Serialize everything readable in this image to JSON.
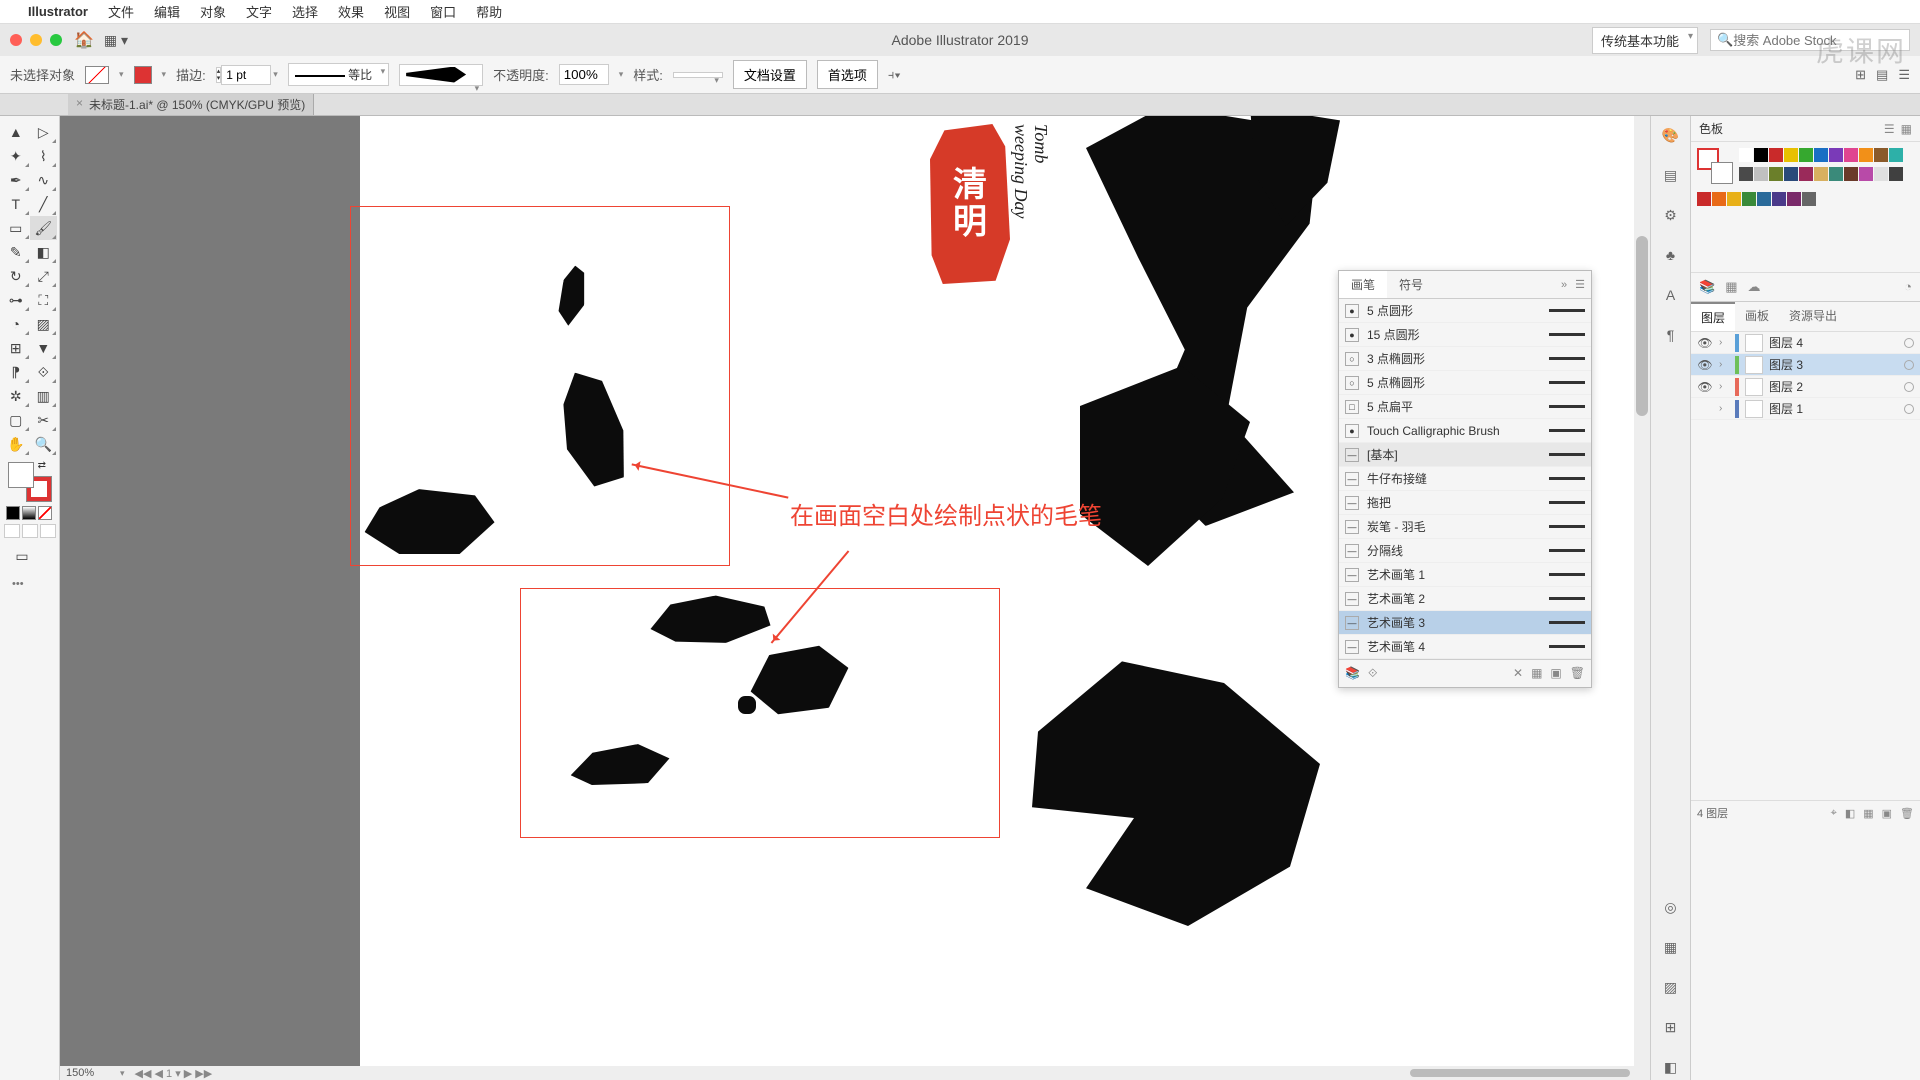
{
  "menubar": {
    "appname": "Illustrator",
    "items": [
      "文件",
      "编辑",
      "对象",
      "文字",
      "选择",
      "效果",
      "视图",
      "窗口",
      "帮助"
    ]
  },
  "titlebar": {
    "title": "Adobe Illustrator 2019",
    "workspace": "传统基本功能",
    "search_placeholder": "搜索 Adobe Stock"
  },
  "controlbar": {
    "selection": "未选择对象",
    "stroke_label": "描边:",
    "stroke_weight": "1 pt",
    "profile": "等比",
    "opacity_label": "不透明度:",
    "opacity": "100%",
    "style_label": "样式:",
    "btn_docsetup": "文档设置",
    "btn_prefs": "首选项"
  },
  "doctab": {
    "name": "未标题-1.ai* @ 150% (CMYK/GPU 预览)"
  },
  "zoom": "150%",
  "canvas": {
    "seal_top": "清",
    "seal_bot": "明",
    "calig1": "Tomb",
    "calig2": "weeping Day",
    "annotation": "在画面空白处绘制点状的毛笔"
  },
  "brushes": {
    "tab1": "画笔",
    "tab2": "符号",
    "items": [
      {
        "label": "5 点圆形",
        "thumb": "●"
      },
      {
        "label": "15 点圆形",
        "thumb": "●"
      },
      {
        "label": "3 点椭圆形",
        "thumb": "○"
      },
      {
        "label": "5 点椭圆形",
        "thumb": "○"
      },
      {
        "label": "5 点扁平",
        "thumb": "□"
      },
      {
        "label": "Touch Calligraphic Brush",
        "thumb": "●"
      },
      {
        "label": "[基本]",
        "thumb": "",
        "group": true
      },
      {
        "label": "牛仔布接缝",
        "thumb": ""
      },
      {
        "label": "拖把",
        "thumb": ""
      },
      {
        "label": "炭笔 - 羽毛",
        "thumb": ""
      },
      {
        "label": "分隔线",
        "thumb": ""
      },
      {
        "label": "艺术画笔 1",
        "thumb": ""
      },
      {
        "label": "艺术画笔 2",
        "thumb": ""
      },
      {
        "label": "艺术画笔 3",
        "thumb": "",
        "selected": true
      },
      {
        "label": "艺术画笔 4",
        "thumb": ""
      }
    ]
  },
  "swatches_panel": {
    "title": "色板"
  },
  "layers_panel": {
    "tabs": [
      "图层",
      "画板",
      "资源导出"
    ],
    "layers": [
      {
        "name": "图层 4",
        "color": "#5aa0d8",
        "visible": true
      },
      {
        "name": "图层 3",
        "color": "#6ec05a",
        "visible": true,
        "selected": true
      },
      {
        "name": "图层 2",
        "color": "#e76a5a",
        "visible": true
      },
      {
        "name": "图层 1",
        "color": "#5a7bbb",
        "visible": false
      }
    ],
    "footer": "4 图层"
  },
  "swatch_colors": [
    "#ffffff",
    "#000000",
    "#c92a2a",
    "#e8c000",
    "#36a82f",
    "#1a6fc4",
    "#7a3ab8",
    "#e04590",
    "#f29018",
    "#8a5a2a",
    "#2db0a8",
    "#4a4a4a",
    "#c0c0c0",
    "#6b7f2a",
    "#2a4a7a",
    "#9a2a5a",
    "#d8b060",
    "#3a8a7a",
    "#6a3a2a",
    "#b84aa8",
    "#e0e0e0",
    "#404040"
  ],
  "swatch_colors2": [
    "#c92a2a",
    "#e86a18",
    "#e8b018",
    "#3a8a3a",
    "#2a6a9a",
    "#4a3a8a",
    "#7a2a6a",
    "#666666"
  ],
  "watermark": "虎课网"
}
